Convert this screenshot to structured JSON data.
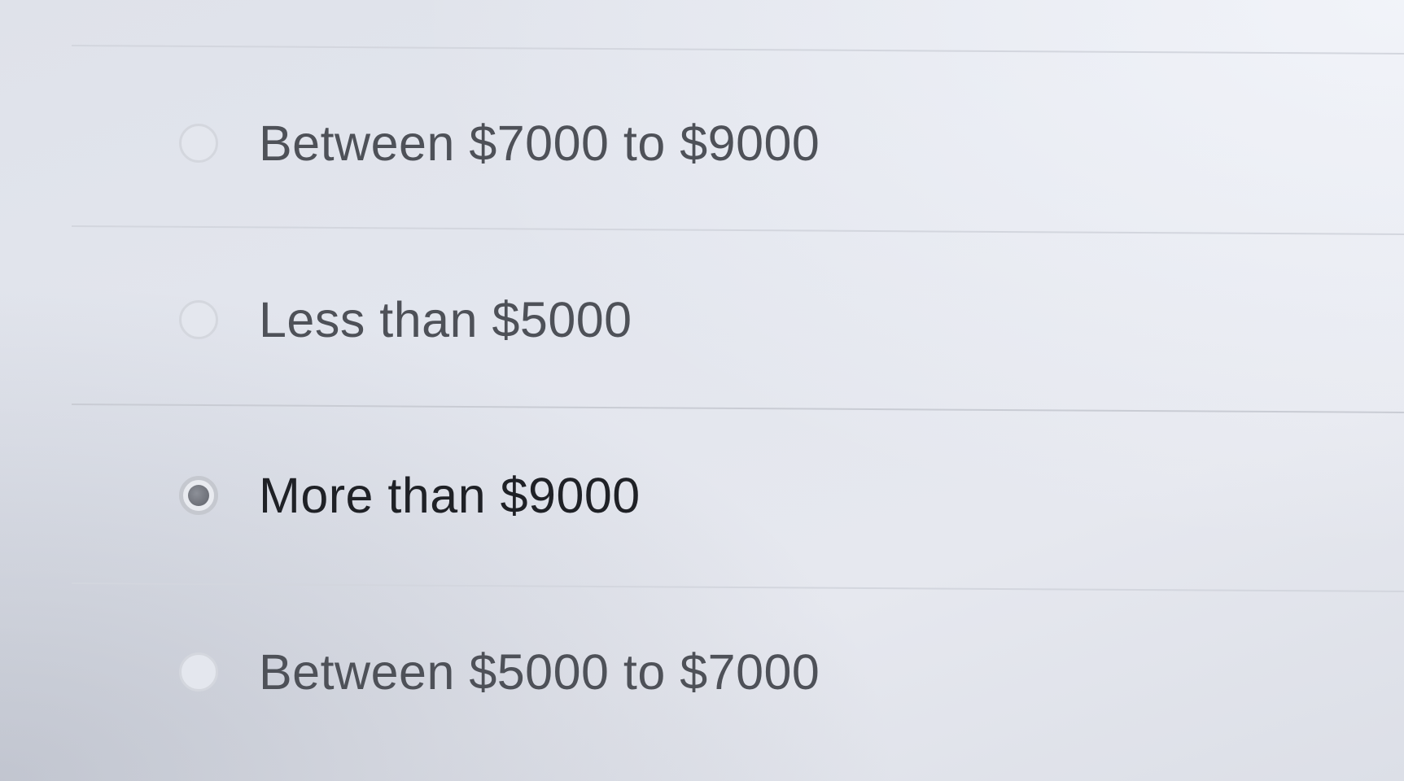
{
  "question": {
    "options": [
      {
        "label": "Between $7000 to $9000",
        "selected": false
      },
      {
        "label": "Less than $5000",
        "selected": false
      },
      {
        "label": "More than $9000",
        "selected": true
      },
      {
        "label": "Between $5000 to $7000",
        "selected": false
      }
    ]
  },
  "colors": {
    "background": "#e3e6ee",
    "divider": "#d3d6de",
    "radio_checked_dot": "#6d7078",
    "label_text": "#4e5158",
    "label_selected_text": "#1f2126"
  }
}
